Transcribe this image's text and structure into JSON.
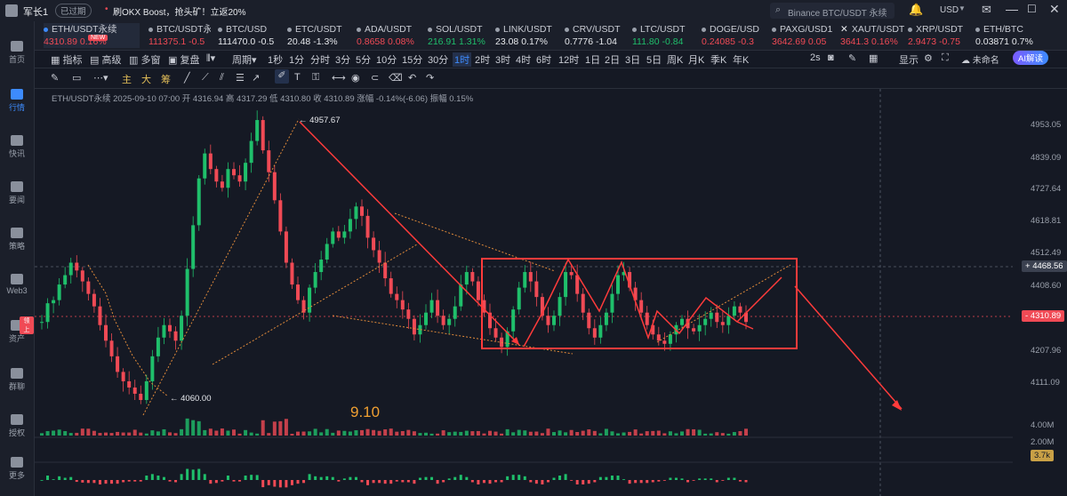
{
  "topbar": {
    "user_name": "军长1",
    "expired_badge": "已过期",
    "promo_text": "刷OKX Boost，抢头矿！立返20%",
    "search_placeholder": "Binance BTC/USDT 永续",
    "currency": "USD"
  },
  "sidebar": {
    "items": [
      {
        "label": "首页"
      },
      {
        "label": "行情"
      },
      {
        "label": "快讯"
      },
      {
        "label": "要闻"
      },
      {
        "label": "策略"
      },
      {
        "label": "Web3"
      },
      {
        "label": "资产",
        "badge": "领上"
      },
      {
        "label": "群聊"
      },
      {
        "label": "授权"
      },
      {
        "label": "更多"
      }
    ]
  },
  "tickers": [
    {
      "symbol": "ETH/USDT永续",
      "price": "4310.89",
      "change": "0.16%",
      "dir": "dn",
      "badge": "NEW"
    },
    {
      "symbol": "BTC/USDT永续",
      "price": "111375.1",
      "change": "-0.5",
      "dir": "dn"
    },
    {
      "symbol": "BTC/USD",
      "price": "111470.0",
      "change": "-0.5",
      "dir": "wh"
    },
    {
      "symbol": "ETC/USDT",
      "price": "20.48",
      "change": "-1.3%",
      "dir": "wh"
    },
    {
      "symbol": "ADA/USDT",
      "price": "0.8658",
      "change": "0.08%",
      "dir": "dn"
    },
    {
      "symbol": "SOL/USDT",
      "price": "216.91",
      "change": "1.31%",
      "dir": "up"
    },
    {
      "symbol": "LINK/USDT",
      "price": "23.08",
      "change": "0.17%",
      "dir": "wh"
    },
    {
      "symbol": "CRV/USDT",
      "price": "0.7776",
      "change": "-1.04",
      "dir": "wh"
    },
    {
      "symbol": "LTC/USDT",
      "price": "111.80",
      "change": "-0.84",
      "dir": "up"
    },
    {
      "symbol": "DOGE/USD",
      "price": "0.24085",
      "change": "-0.3",
      "dir": "dn"
    },
    {
      "symbol": "PAXG/USD1",
      "price": "3642.69",
      "change": "0.05",
      "dir": "dn"
    },
    {
      "symbol": "XAUT/USDT",
      "price": "3641.3",
      "change": "0.16%",
      "dir": "dn"
    },
    {
      "symbol": "XRP/USDT",
      "price": "2.9473",
      "change": "-0.75",
      "dir": "dn"
    },
    {
      "symbol": "ETH/BTC",
      "price": "0.03871",
      "change": "0.7%",
      "dir": "wh"
    }
  ],
  "toolbar": {
    "indicators": "指标",
    "advanced": "高级",
    "multi_window": "多窗",
    "replay": "复盘",
    "period": "周期",
    "timeframes": [
      "1秒",
      "1分",
      "分时",
      "3分",
      "5分",
      "10分",
      "15分",
      "30分",
      "1时",
      "2时",
      "3时",
      "4时",
      "6时",
      "12时",
      "1日",
      "2日",
      "3日",
      "5日",
      "周K",
      "月K",
      "季K",
      "年K"
    ],
    "selected_timeframe": "1时",
    "speed": "2s",
    "display": "显示",
    "unnamed": "未命名",
    "ai_button": "AI解读"
  },
  "drawbar": {
    "main": "主",
    "big": "大",
    "chou": "筹"
  },
  "chart": {
    "ohlc_line": "ETH/USDT永续 2025-09-10 07:00 开 4316.94 高 4317.29 低 4310.80 收 4310.89 涨幅 -0.14%(-6.06) 振幅 0.15%",
    "annotation": "9.10",
    "high_label": "4957.67",
    "low_label": "4060.00",
    "current_price_tag": "4310.89",
    "crosshair_price_tag": "4468.56",
    "vol_tag": "3.7k",
    "y_axis": [
      "4953.05",
      "4839.09",
      "4727.64",
      "4618.81",
      "4512.49",
      "4408.60",
      "4207.96",
      "4111.09"
    ],
    "vol_axis": [
      "4.00M",
      "2.00M"
    ]
  },
  "colors": {
    "up": "#1fbf6b",
    "down": "#f04a55",
    "accent": "#3d8bfd",
    "drawing": "#ff3b3b"
  },
  "chart_data": {
    "type": "candlestick",
    "title": "ETH/USDT永续",
    "timeframe": "1时",
    "ylim": [
      4060,
      4960
    ],
    "trend_values": [
      4310,
      4370,
      4380,
      4430,
      4460,
      4500,
      4475,
      4440,
      4400,
      4360,
      4300,
      4250,
      4200,
      4150,
      4120,
      4100,
      4080,
      4060,
      4120,
      4200,
      4260,
      4300,
      4280,
      4250,
      4330,
      4480,
      4620,
      4770,
      4850,
      4800,
      4760,
      4740,
      4800,
      4780,
      4760,
      4820,
      4890,
      4957,
      4860,
      4790,
      4700,
      4600,
      4500,
      4430,
      4380,
      4340,
      4420,
      4470,
      4510,
      4560,
      4600,
      4580,
      4600,
      4640,
      4680,
      4650,
      4580,
      4540,
      4500,
      4450,
      4400,
      4380,
      4350,
      4320,
      4270,
      4300,
      4340,
      4380,
      4330,
      4300,
      4320,
      4360,
      4430,
      4470,
      4440,
      4380,
      4340,
      4290,
      4260,
      4230,
      4280,
      4350,
      4420,
      4470,
      4440,
      4390,
      4330,
      4300,
      4330,
      4390,
      4470,
      4460,
      4400,
      4340,
      4290,
      4260,
      4300,
      4340,
      4400,
      4460,
      4470,
      4420,
      4380,
      4340,
      4300,
      4270,
      4250,
      4240,
      4270,
      4300,
      4320,
      4290,
      4280,
      4300,
      4320,
      4340,
      4310,
      4300,
      4330,
      4360,
      4340,
      4310
    ]
  }
}
